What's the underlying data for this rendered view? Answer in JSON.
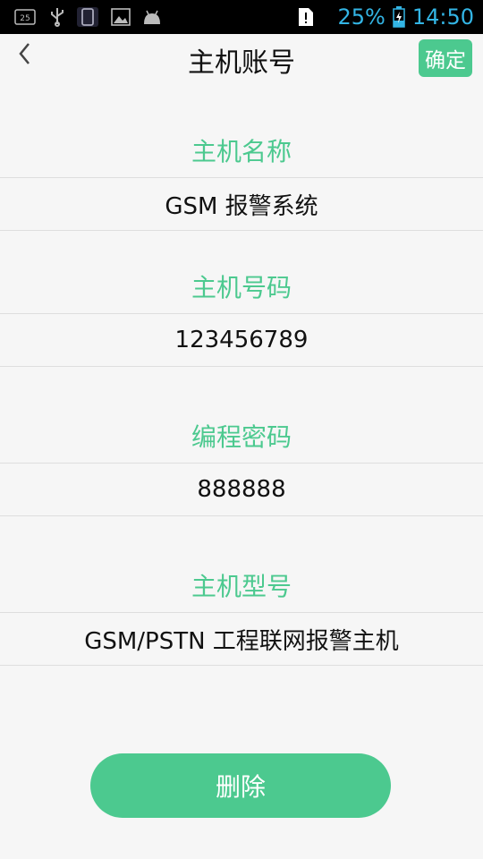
{
  "statusbar": {
    "notification_badge": "25",
    "battery_percent": "25%",
    "time": "14:50",
    "icons": [
      "notification-25-icon",
      "usb-icon",
      "phone-icon",
      "image-icon",
      "android-icon",
      "alert-icon",
      "battery-charging-icon"
    ],
    "accent_color": "#33b5e5"
  },
  "header": {
    "back_icon": "chevron-left-icon",
    "title": "主机账号",
    "confirm_label": "确定"
  },
  "fields": [
    {
      "label": "主机名称",
      "value": "GSM 报警系统"
    },
    {
      "label": "主机号码",
      "value": "123456789"
    },
    {
      "label": "编程密码",
      "value": "888888"
    },
    {
      "label": "主机型号",
      "value": "GSM/PSTN 工程联网报警主机"
    }
  ],
  "delete_label": "删除",
  "colors": {
    "accent": "#4cc98f",
    "background": "#f6f6f6"
  }
}
